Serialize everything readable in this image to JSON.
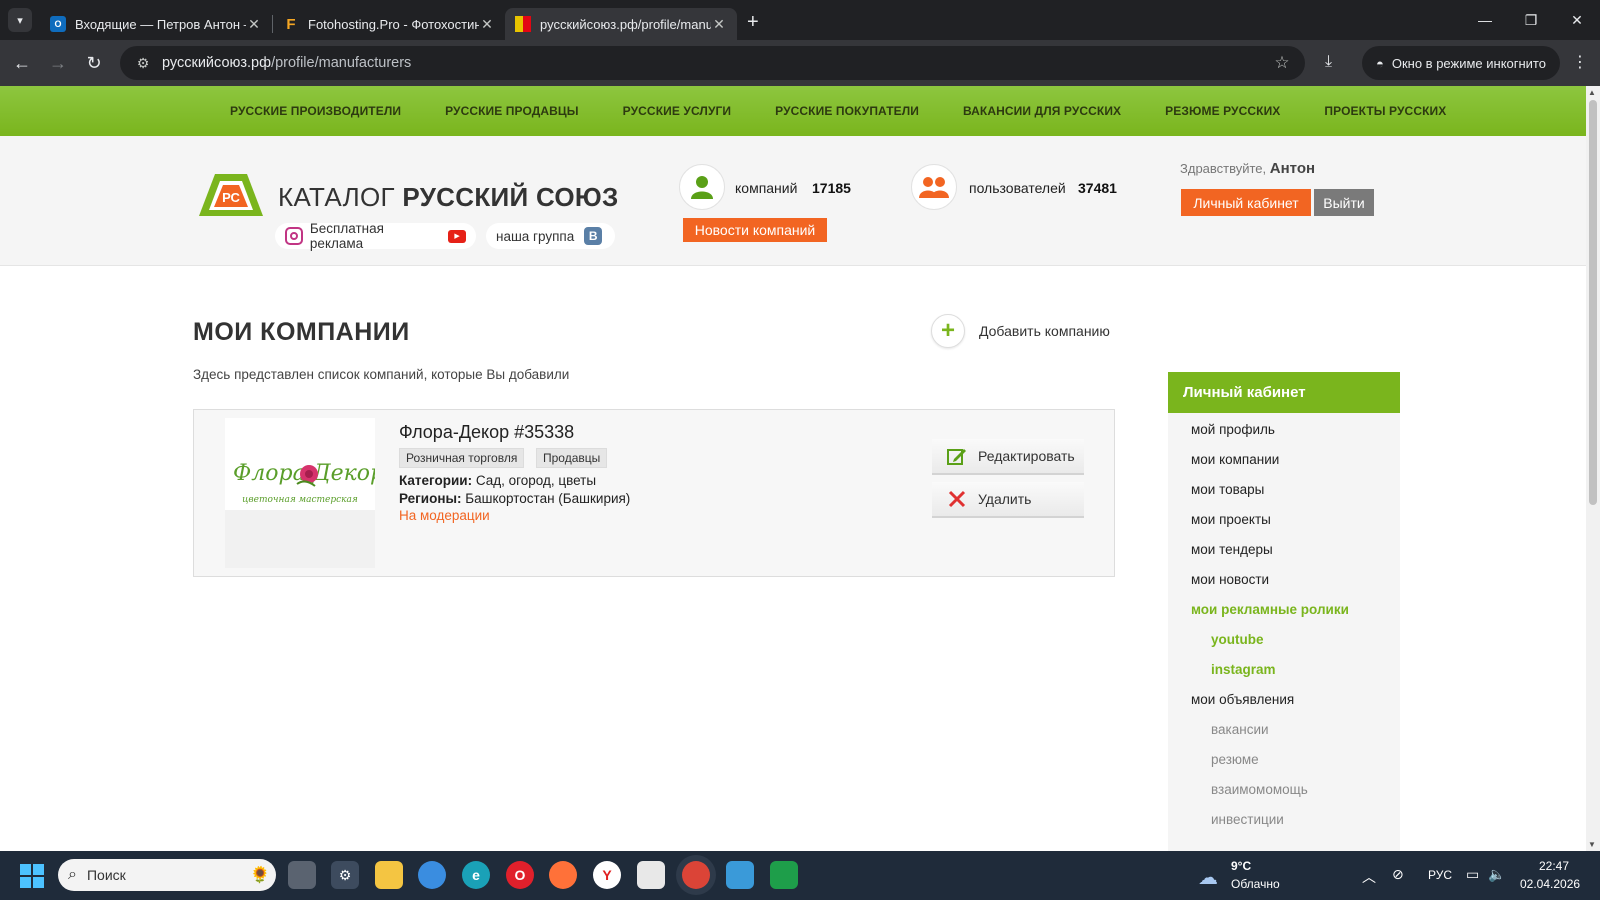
{
  "browser": {
    "tabs": [
      {
        "title": "Входящие — Петров Антон —",
        "favicon": "outlook-icon"
      },
      {
        "title": "Fotohosting.Pro - Фотохостинг",
        "favicon": "F"
      },
      {
        "title": "русскийсоюз.рф/profile/manuf",
        "favicon": "flag-icon"
      }
    ],
    "url_host": "русскийсоюз.рф",
    "url_path": "/profile/manufacturers",
    "incognito_label": "Окно в режиме инкогнито"
  },
  "topnav": [
    "РУССКИЕ ПРОИЗВОДИТЕЛИ",
    "РУССКИЕ ПРОДАВЦЫ",
    "РУССКИЕ УСЛУГИ",
    "РУССКИЕ ПОКУПАТЕЛИ",
    "ВАКАНСИИ ДЛЯ РУССКИХ",
    "РЕЗЮМЕ РУССКИХ",
    "ПРОЕКТЫ РУССКИХ"
  ],
  "header": {
    "logo_letters": "РС",
    "logo_prefix": "КАТАЛОГ",
    "logo_bold": "РУССКИЙ СОЮЗ",
    "ad_label": "Бесплатная реклама",
    "group_label": "наша группа",
    "vk_letter": "В",
    "companies_label": "компаний",
    "companies_count": "17185",
    "users_label": "пользователей",
    "users_count": "37481",
    "news_button": "Новости компаний",
    "greeting": "Здравствуйте,",
    "user_name": "Антон",
    "cabinet_button": "Личный кабинет",
    "logout_button": "Выйти"
  },
  "main": {
    "title": "МОИ КОМПАНИИ",
    "add_company": "Добавить компанию",
    "subtitle": "Здесь представлен список компаний, которые Вы добавили",
    "company": {
      "name": "Флора-Декор #35338",
      "logo_text": "Флора Декор",
      "logo_tagline": "цветочная мастерская",
      "tags": [
        "Розничная торговля",
        "Продавцы"
      ],
      "categories_label": "Категории:",
      "categories": "Сад, огород, цветы",
      "regions_label": "Регионы:",
      "regions": "Башкортостан (Башкирия)",
      "status": "На модерации",
      "edit_button": "Редактировать",
      "delete_button": "Удалить"
    }
  },
  "sidebar": {
    "title": "Личный кабинет",
    "items": [
      {
        "label": "мой профиль",
        "style": "normal"
      },
      {
        "label": "мои компании",
        "style": "normal"
      },
      {
        "label": "мои товары",
        "style": "normal"
      },
      {
        "label": "мои проекты",
        "style": "normal"
      },
      {
        "label": "мои тендеры",
        "style": "normal"
      },
      {
        "label": "мои новости",
        "style": "normal"
      },
      {
        "label": "мои рекламные ролики",
        "style": "green"
      },
      {
        "label": "youtube",
        "style": "green-sub"
      },
      {
        "label": "instagram",
        "style": "green-sub"
      },
      {
        "label": "мои объявления",
        "style": "normal"
      },
      {
        "label": "вакансии",
        "style": "grey-sub"
      },
      {
        "label": "резюме",
        "style": "grey-sub"
      },
      {
        "label": "взаимомомощь",
        "style": "grey-sub"
      },
      {
        "label": "инвестиции",
        "style": "grey-sub"
      }
    ]
  },
  "taskbar": {
    "search_placeholder": "Поиск",
    "weather_temp": "9°C",
    "weather_desc": "Облачно",
    "lang": "РУС",
    "time": "22:47",
    "date": "02.04.2026"
  },
  "colors": {
    "brand_green": "#7ab51d",
    "accent_orange": "#f26522",
    "chrome_dark": "#202124"
  }
}
